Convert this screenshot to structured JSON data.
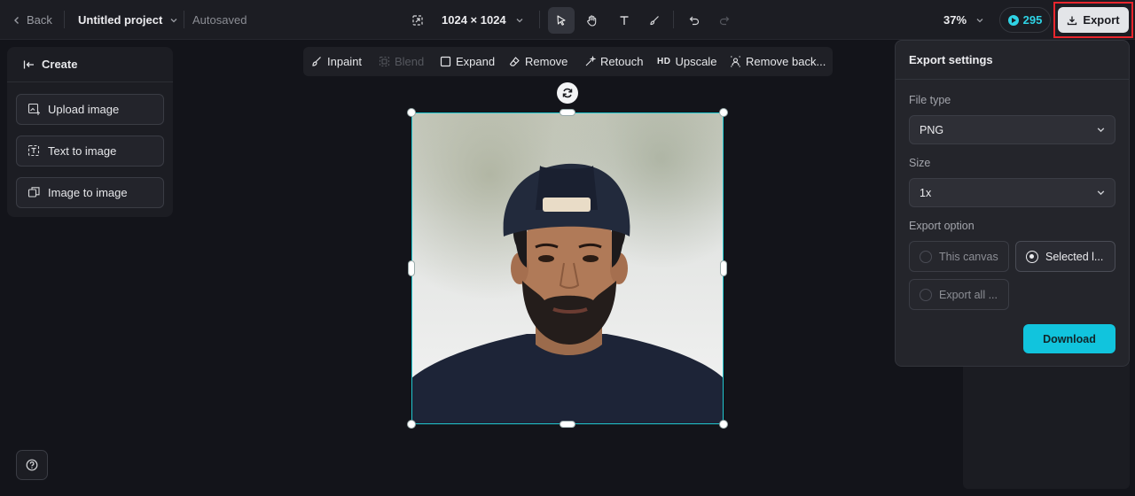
{
  "topbar": {
    "back_label": "Back",
    "project_name": "Untitled project",
    "autosave_status": "Autosaved",
    "dimensions": "1024 × 1024",
    "zoom": "37%",
    "credits": "295",
    "export_label": "Export"
  },
  "left_panel": {
    "title": "Create",
    "items": [
      {
        "label": "Upload image",
        "icon": "upload-image-icon"
      },
      {
        "label": "Text to image",
        "icon": "text-to-image-icon"
      },
      {
        "label": "Image to image",
        "icon": "image-to-image-icon"
      }
    ]
  },
  "edit_toolbar": {
    "items": [
      {
        "label": "Inpaint",
        "icon": "inpaint-icon",
        "enabled": true
      },
      {
        "label": "Blend",
        "icon": "blend-icon",
        "enabled": false
      },
      {
        "label": "Expand",
        "icon": "expand-icon",
        "enabled": true
      },
      {
        "label": "Remove",
        "icon": "eraser-icon",
        "enabled": true
      },
      {
        "label": "Retouch",
        "icon": "retouch-icon",
        "enabled": true
      },
      {
        "label": "Upscale",
        "badge": "HD",
        "enabled": true
      },
      {
        "label": "Remove back...",
        "icon": "remove-background-icon",
        "enabled": true
      }
    ]
  },
  "export_settings": {
    "title": "Export settings",
    "file_type_label": "File type",
    "file_type_value": "PNG",
    "size_label": "Size",
    "size_value": "1x",
    "export_option_label": "Export option",
    "options": [
      {
        "label": "This canvas",
        "selected": false
      },
      {
        "label": "Selected l...",
        "selected": true
      },
      {
        "label": "Export all ...",
        "selected": false
      }
    ],
    "download_label": "Download"
  },
  "colors": {
    "accent": "#11c4dd",
    "credits": "#2fd3e5",
    "selection": "#20c7cf",
    "highlight": "#e8262d"
  }
}
